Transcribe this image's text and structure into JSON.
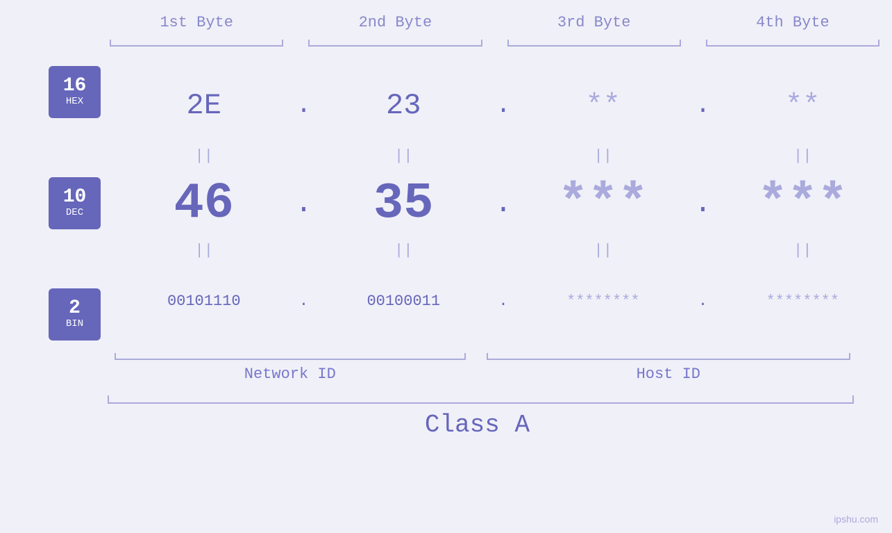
{
  "headers": {
    "byte1": "1st Byte",
    "byte2": "2nd Byte",
    "byte3": "3rd Byte",
    "byte4": "4th Byte"
  },
  "badges": [
    {
      "number": "16",
      "label": "HEX"
    },
    {
      "number": "10",
      "label": "DEC"
    },
    {
      "number": "2",
      "label": "BIN"
    }
  ],
  "hex": {
    "b1": "2E",
    "b2": "23",
    "b3": "**",
    "b4": "**",
    "dot": "."
  },
  "dec": {
    "b1": "46",
    "b2": "35",
    "b3": "***",
    "b4": "***",
    "dot": "."
  },
  "bin": {
    "b1": "00101110",
    "b2": "00100011",
    "b3": "********",
    "b4": "********",
    "dot": "."
  },
  "labels": {
    "network_id": "Network ID",
    "host_id": "Host ID",
    "class": "Class A"
  },
  "watermark": "ipshu.com",
  "eq_sign": "||"
}
